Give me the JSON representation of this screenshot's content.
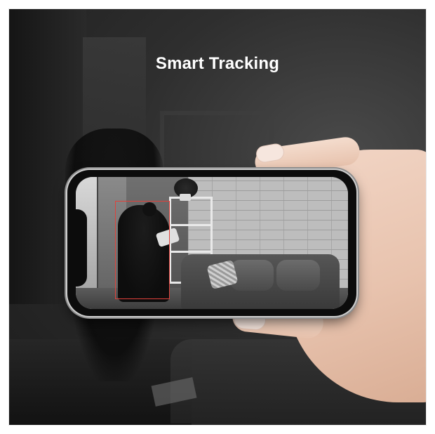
{
  "title": "Smart Tracking"
}
